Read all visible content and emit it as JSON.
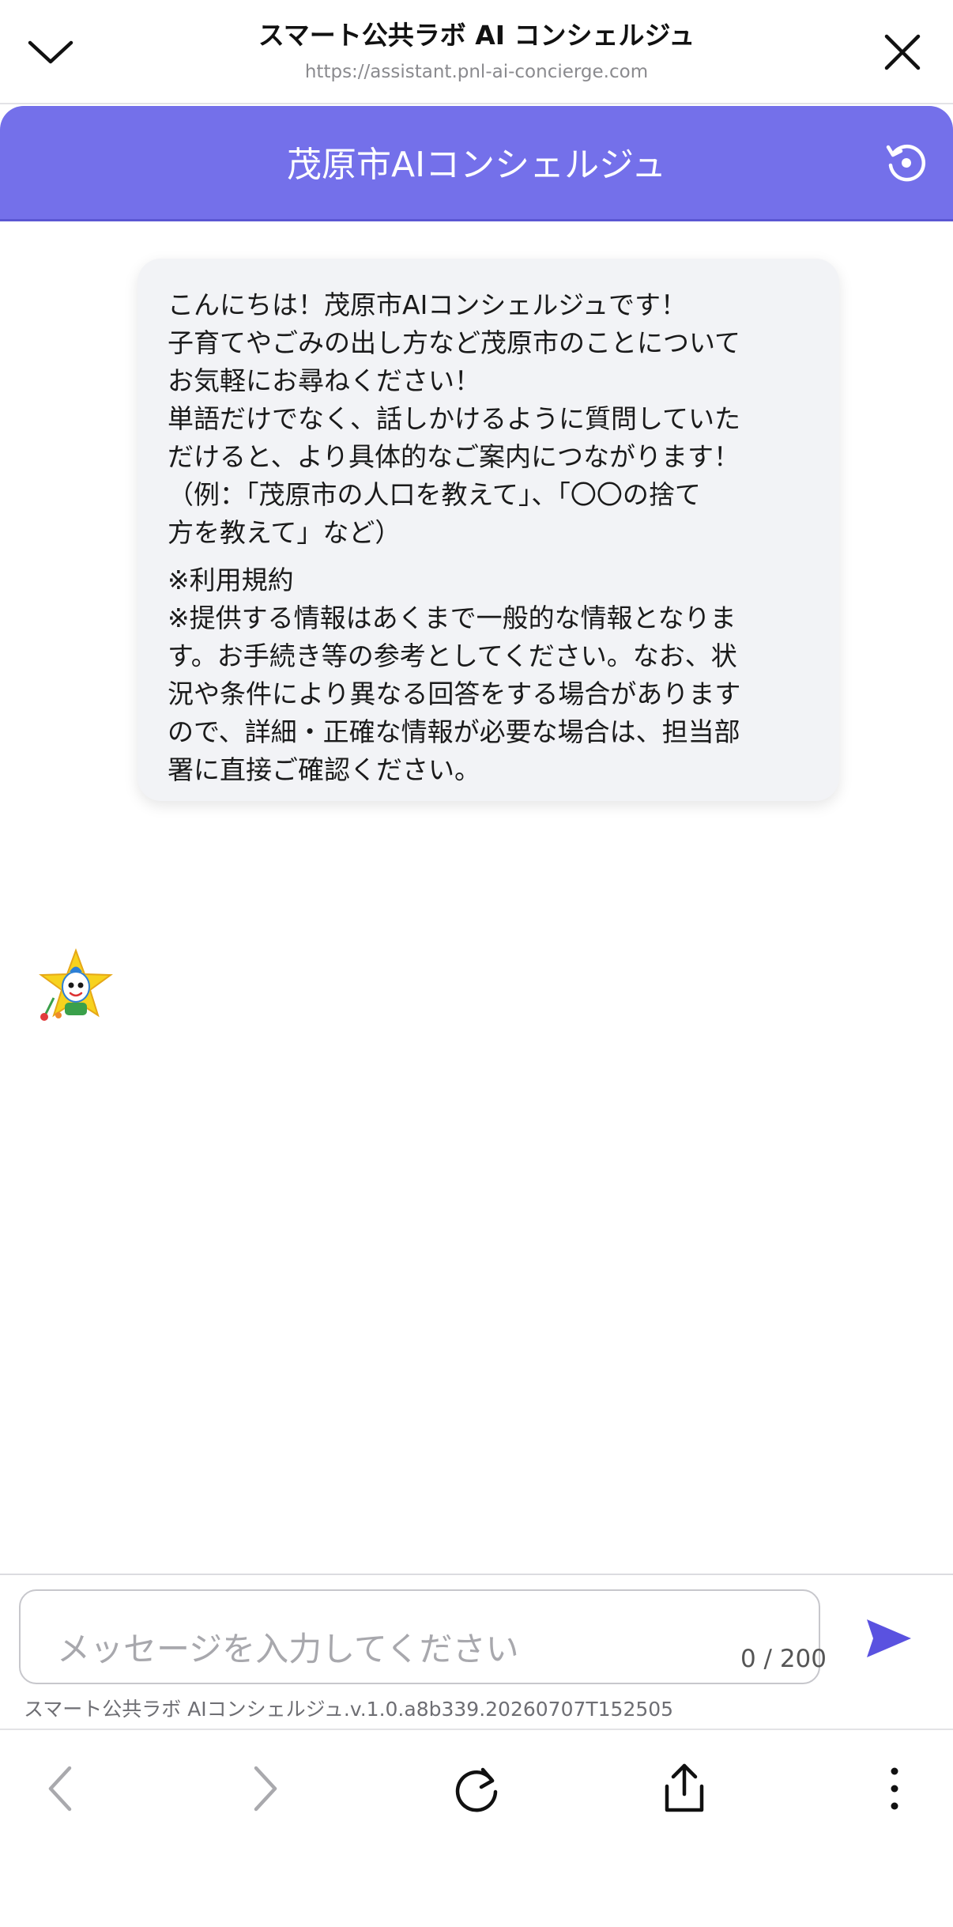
{
  "browser": {
    "title": "スマート公共ラボ AI コンシェルジュ",
    "url": "https://assistant.pnl-ai-concierge.com",
    "icons": {
      "collapse": "chevron-down-icon",
      "close": "close-icon"
    }
  },
  "header": {
    "title": "茂原市AIコンシェルジュ",
    "reset_icon": "reset-icon",
    "accent_color": "#7470ea"
  },
  "chat": {
    "messages": [
      {
        "role": "assistant",
        "paragraphs": [
          "こんにちは！茂原市AIコンシェルジュです！\n子育てやごみの出し方など茂原市のことについて\nお気軽にお尋ねください！\n単語だけでなく、話しかけるように質問していた\nだけると、より具体的なご案内につながります！\n（例：「茂原市の人口を教えて」、「〇〇の捨て\n方を教えて」など）",
          "※利用規約\n※提供する情報はあくまで一般的な情報となりま\nす。お手続き等の参考としてください。なお、状\n況や条件により異なる回答をする場合があります\nので、詳細・正確な情報が必要な場合は、担当部\n署に直接ご確認ください。"
        ]
      }
    ]
  },
  "input": {
    "placeholder": "メッセージを入力してください",
    "value": "",
    "char_count": "0 / 200",
    "send_icon": "send-icon"
  },
  "footer": {
    "version": "スマート公共ラボ AIコンシェルジュ.v.1.0.a8b339.20260707T152505"
  },
  "toolbar": {
    "icons": [
      "back-icon",
      "forward-icon",
      "reload-icon",
      "share-icon",
      "more-icon"
    ]
  }
}
